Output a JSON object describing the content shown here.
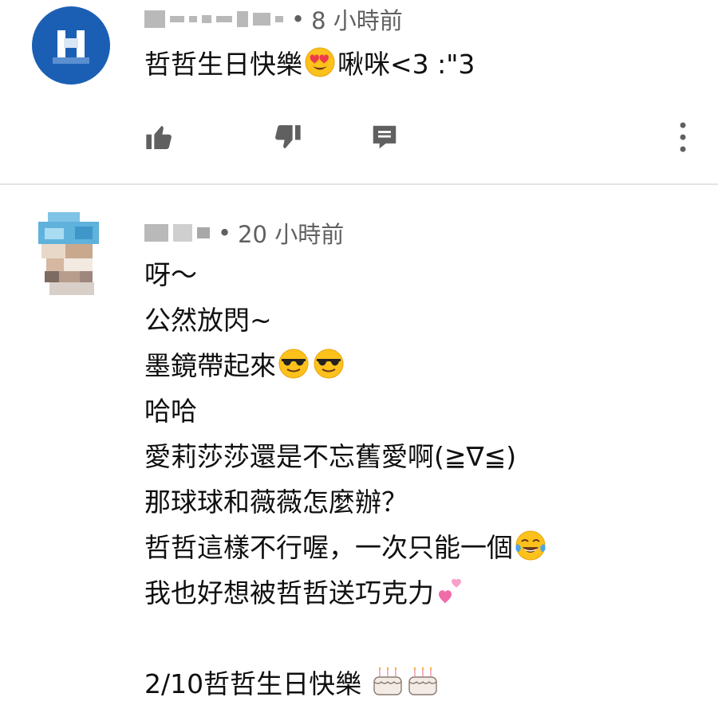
{
  "comments": [
    {
      "name": "",
      "timestamp": "8 小時前",
      "text": "哲哲生日快樂",
      "text_after_emoji": "啾咪<3 :\"3",
      "emoji": "heart-eyes-face-icon",
      "actions": {
        "like": "thumbs-up-icon",
        "dislike": "thumbs-down-icon",
        "reply": "reply-comment-icon",
        "more": "more-vertical-icon"
      }
    },
    {
      "name": "",
      "timestamp": "20 小時前",
      "lines": [
        "呀～",
        "公然放閃~",
        "墨鏡帶起來",
        "哈哈",
        "愛莉莎莎還是不忘舊愛啊(≧∇≦)",
        "那球球和薇薇怎麼辦？",
        "哲哲這樣不行喔，一次只能一個",
        "我也好想被哲哲送巧克力",
        "",
        "2/10哲哲生日快樂 "
      ],
      "line_emojis": {
        "2": [
          "sunglasses-face-icon",
          "sunglasses-face-icon"
        ],
        "6": [
          "tears-of-joy-face-icon"
        ],
        "7": [
          "two-hearts-icon"
        ],
        "9": [
          "birthday-cake-icon",
          "birthday-cake-icon"
        ]
      }
    }
  ],
  "colors": {
    "text": "#0f0f0f",
    "meta": "#606060",
    "icon": "#606060",
    "divider": "#e3e3e3",
    "avatar_blue": "#1a5fb4"
  },
  "separator": "•"
}
